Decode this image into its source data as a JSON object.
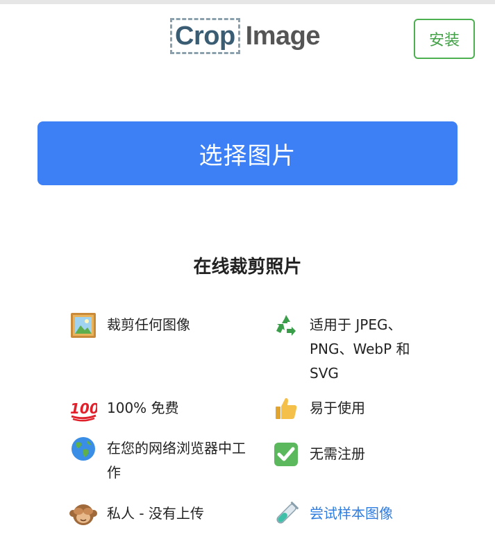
{
  "logo": {
    "crop": "Crop",
    "image": "Image"
  },
  "header": {
    "install_label": "安装"
  },
  "main": {
    "select_button_label": "选择图片",
    "section_title": "在线裁剪照片"
  },
  "features": {
    "crop_any": "裁剪任何图像",
    "formats": "适用于 JPEG、PNG、WebP 和 SVG",
    "free": "100% 免费",
    "easy": "易于使用",
    "browser": "在您的网络浏览器中工作",
    "no_signup": "无需注册",
    "private": "私人 - 没有上传",
    "try_sample": "尝试样本图像"
  },
  "icons": {
    "crop_any": "framed-picture-icon",
    "formats": "recycle-icon",
    "free": "hundred-points-icon",
    "easy": "thumbs-up-icon",
    "browser": "globe-icon",
    "no_signup": "check-mark-button-icon",
    "private": "see-no-evil-monkey-icon",
    "try_sample": "test-tube-icon"
  },
  "colors": {
    "primary": "#3d80f5",
    "install_green": "#43a047",
    "link": "#2f7de1",
    "logo_crop": "#3b5d74",
    "logo_image": "#555555"
  }
}
